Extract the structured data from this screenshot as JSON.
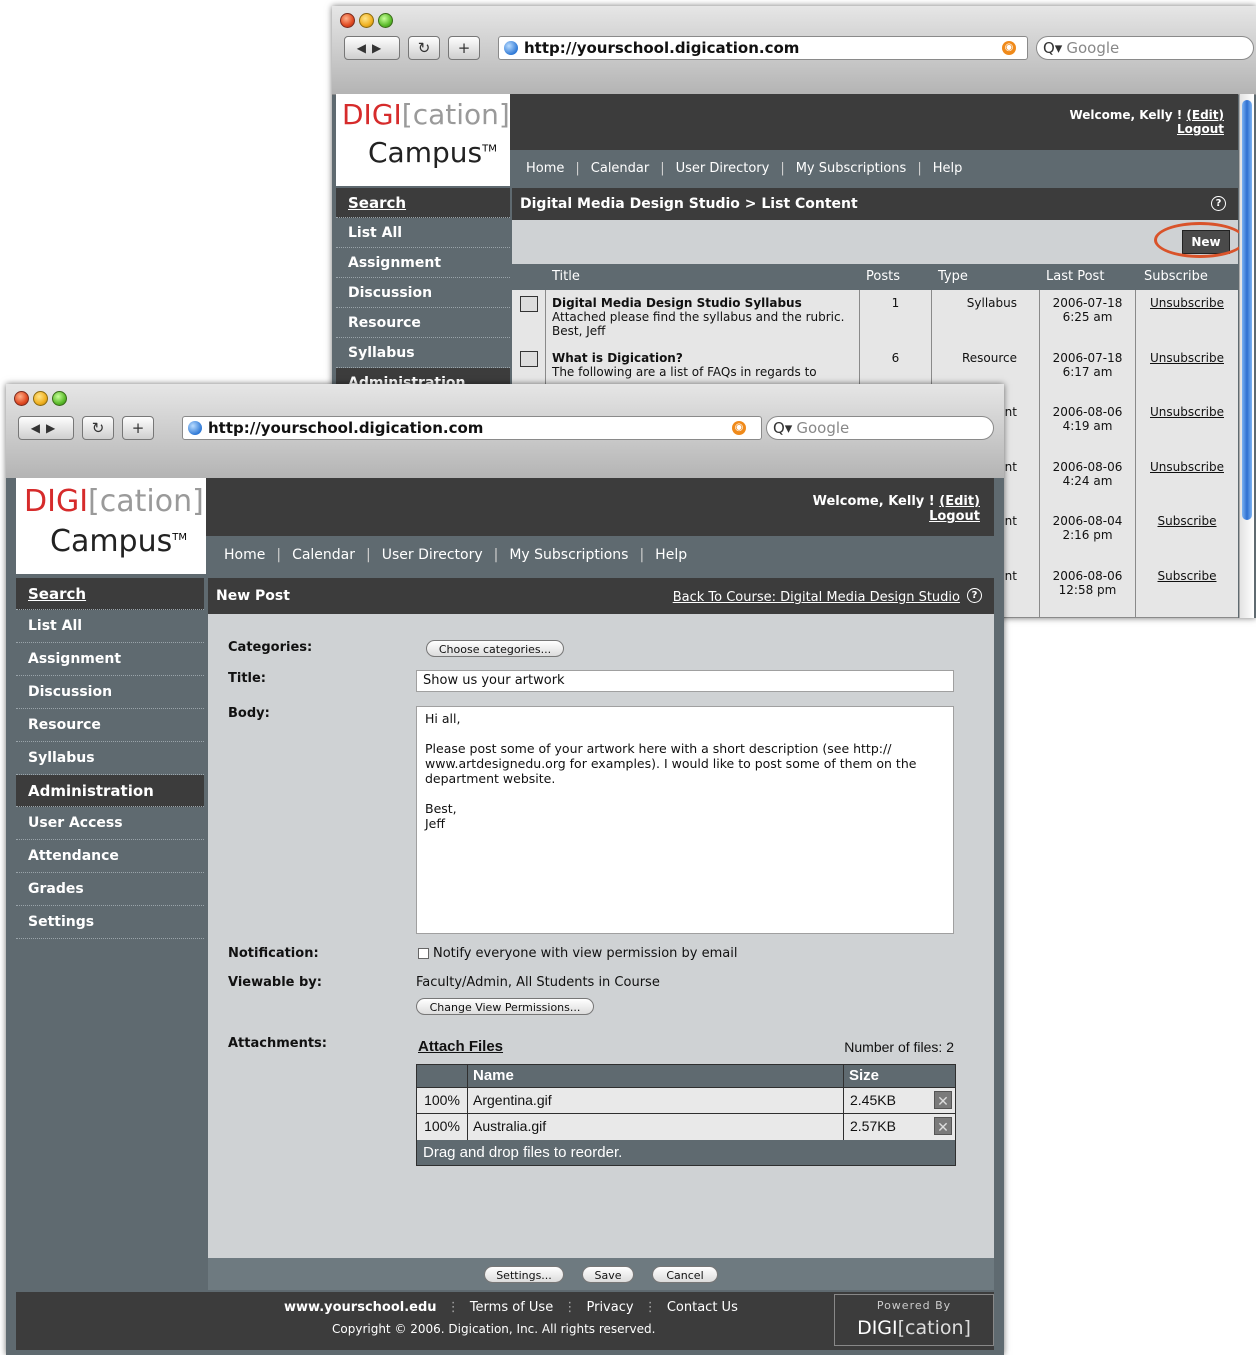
{
  "browser": {
    "url": "http://yourschool.digication.com",
    "search_placeholder": "Google"
  },
  "logo": {
    "digi": "DIGI",
    "cation": "[cation]",
    "campus": "Campus",
    "tm": "TM"
  },
  "header": {
    "welcome": "Welcome, Kelly !",
    "edit": "(Edit)",
    "logout": "Logout"
  },
  "topnav": [
    "Home",
    "Calendar",
    "User Directory",
    "My Subscriptions",
    "Help"
  ],
  "back_window": {
    "sidebar": [
      "Search",
      "List All",
      "Assignment",
      "Discussion",
      "Resource",
      "Syllabus",
      "Administration"
    ],
    "title": "Digital Media Design Studio > List Content",
    "new_button": "New",
    "columns": [
      "Title",
      "Posts",
      "Type",
      "Last Post",
      "Subscribe"
    ],
    "rows": [
      {
        "title": "Digital Media Design Studio Syllabus",
        "desc1": "Attached please find the syllabus and the rubric.",
        "desc2": "Best, Jeff",
        "posts": "1",
        "type": "Syllabus",
        "date": "2006-07-18",
        "time": "6:25 am",
        "sub": "Unsubscribe"
      },
      {
        "title": "What is Digication?",
        "desc1": "The following are a list of FAQs in regards to",
        "desc2": "",
        "posts": "6",
        "type": "Resource",
        "date": "2006-07-18",
        "time": "6:17 am",
        "sub": "Unsubscribe"
      },
      {
        "title": "",
        "desc1": "",
        "desc2": "",
        "posts": "",
        "type": "ent",
        "date": "2006-08-06",
        "time": "4:19 am",
        "sub": "Unsubscribe"
      },
      {
        "title": "",
        "desc1": "",
        "desc2": "",
        "posts": "",
        "type": "ent",
        "date": "2006-08-06",
        "time": "4:24 am",
        "sub": "Unsubscribe"
      },
      {
        "title": "",
        "desc1": "",
        "desc2": "",
        "posts": "",
        "type": "ent",
        "date": "2006-08-04",
        "time": "2:16 pm",
        "sub": "Subscribe"
      },
      {
        "title": "",
        "desc1": "",
        "desc2": "",
        "posts": "",
        "type": "ent",
        "date": "2006-08-06",
        "time": "12:58 pm",
        "sub": "Subscribe"
      }
    ]
  },
  "front_window": {
    "sidebar_top": [
      "Search",
      "List All",
      "Assignment",
      "Discussion",
      "Resource",
      "Syllabus"
    ],
    "sidebar_admin_header": "Administration",
    "sidebar_admin": [
      "User Access",
      "Attendance",
      "Grades",
      "Settings"
    ],
    "title": "New Post",
    "back_link": "Back To Course: Digital Media Design Studio",
    "form": {
      "categories_label": "Categories:",
      "choose_categories": "Choose categories...",
      "title_label": "Title:",
      "title_value": "Show us your artwork",
      "body_label": "Body:",
      "body_lines": [
        "Hi all,",
        "",
        "Please post some of your artwork here with a short description (see http://",
        "www.artdesignedu.org for examples). I would like to post some of them on the",
        "department website.",
        "",
        "Best,",
        "Jeff"
      ],
      "notification_label": "Notification:",
      "notify_text": "Notify everyone with view permission by email",
      "viewable_label": "Viewable by:",
      "viewable_value": "Faculty/Admin, All Students in Course",
      "change_permissions": "Change View Permissions...",
      "attachments_label": "Attachments:",
      "attach_files": "Attach Files",
      "num_files": "Number of files: 2",
      "attach_columns": [
        "Name",
        "Size"
      ],
      "attach_rows": [
        {
          "pct": "100%",
          "name": "Argentina.gif",
          "size": "2.45KB"
        },
        {
          "pct": "100%",
          "name": "Australia.gif",
          "size": "2.57KB"
        }
      ],
      "drag_hint": "Drag and drop files to reorder."
    },
    "buttons": {
      "settings": "Settings...",
      "save": "Save",
      "cancel": "Cancel"
    },
    "footer": {
      "links": [
        "www.yourschool.edu",
        "Terms of Use",
        "Privacy",
        "Contact Us"
      ],
      "copyright": "Copyright © 2006. Digication, Inc. All rights reserved.",
      "powered_by": "Powered By",
      "powered_logo_digi": "DIGI",
      "powered_logo_cation": "[cation]"
    }
  },
  "colors": {
    "dark": "#3c3c3c",
    "slate": "#5f6a70",
    "content_bg": "#cfd2d4",
    "accent_red": "#d62b2b",
    "highlight_circle": "#d9532a"
  }
}
